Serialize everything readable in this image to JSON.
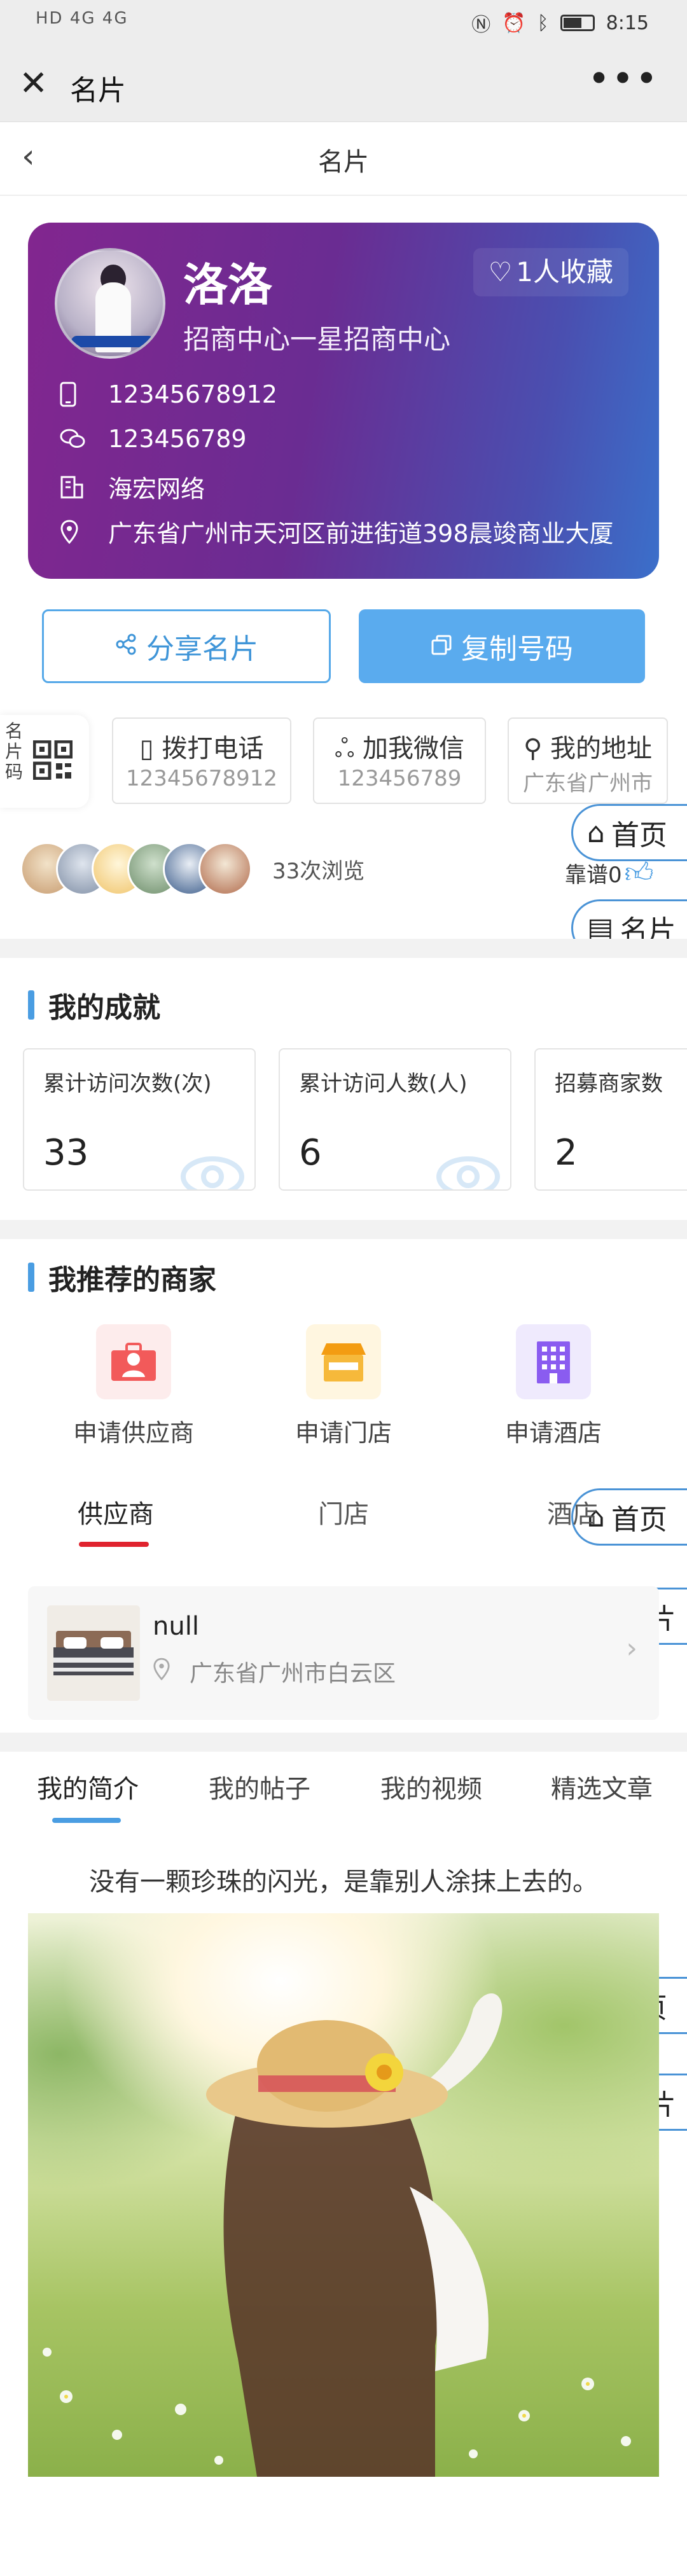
{
  "statusbar": {
    "left": "HD 4G 4G",
    "time": "8:15"
  },
  "wechat": {
    "title": "名片",
    "more": "•••"
  },
  "header": {
    "back": "‹",
    "title": "名片"
  },
  "card": {
    "name": "洛洛",
    "favorites": "1人收藏",
    "org": "招商中心一星招商中心",
    "phone": "12345678912",
    "wechat": "123456789",
    "company": "海宏网络",
    "address": "广东省广州市天河区前进街道398晨竣商业大厦"
  },
  "actions": {
    "share": "分享名片",
    "copy": "复制号码"
  },
  "quick": {
    "card_code": "名片码",
    "items": [
      {
        "title": "拨打电话",
        "sub": "12345678912"
      },
      {
        "title": "加我微信",
        "sub": "123456789"
      },
      {
        "title": "我的地址",
        "sub": "广东省广州市"
      }
    ]
  },
  "visitors": {
    "count_text": "33次浏览",
    "like_text": "靠谱0"
  },
  "floating": {
    "home": "首页",
    "card": "名片"
  },
  "achievements": {
    "title": "我的成就",
    "stats": [
      {
        "label": "累计访问次数(次)",
        "value": "33"
      },
      {
        "label": "累计访问人数(人)",
        "value": "6"
      },
      {
        "label": "招募商家数",
        "value": "2"
      }
    ]
  },
  "merchants": {
    "title": "我推荐的商家",
    "entries": [
      "申请供应商",
      "申请门店",
      "申请酒店"
    ],
    "tabs": [
      "供应商",
      "门店",
      "酒店"
    ],
    "item": {
      "name": "null",
      "address": "广东省广州市白云区"
    }
  },
  "profile": {
    "tabs": [
      "我的简介",
      "我的帖子",
      "我的视频",
      "精选文章"
    ],
    "intro": "没有一颗珍珠的闪光，是靠别人涂抹上去的。"
  },
  "colors": {
    "accent": "#4a9de2",
    "red": "#e0232e",
    "card_start": "#82268f",
    "card_end": "#3b6fca"
  }
}
